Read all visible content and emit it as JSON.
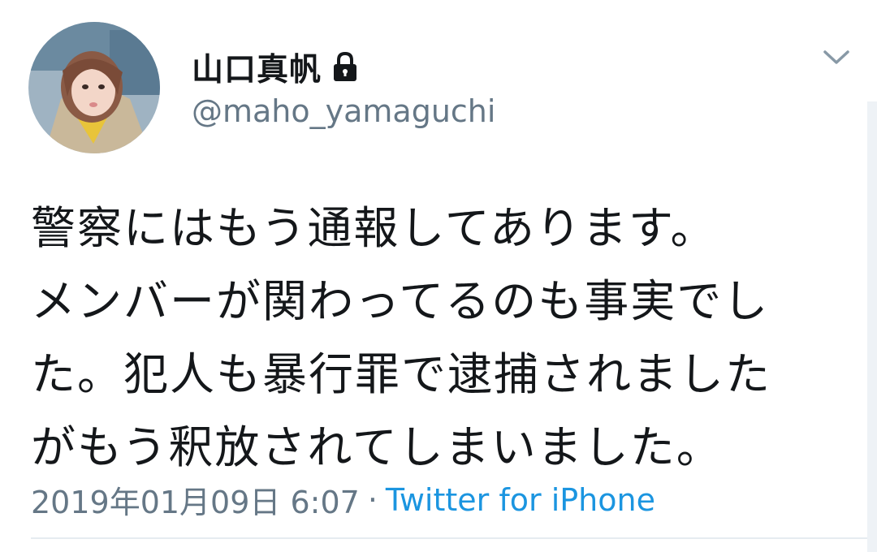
{
  "user": {
    "display_name": "山口真帆",
    "handle": "@maho_yamaguchi",
    "protected_icon": "lock-icon",
    "avatar_icon": "avatar-photo"
  },
  "menu": {
    "icon": "chevron-down-icon"
  },
  "tweet": {
    "lines": [
      "警察にはもう通報してあります。",
      "メンバーが関わってるのも事実でし",
      "た。犯人も暴行罪で逮捕されました",
      "がもう釈放されてしまいました。"
    ]
  },
  "meta": {
    "timestamp": "2019年01月09日 6:07",
    "separator": "·",
    "source": "Twitter for iPhone"
  },
  "colors": {
    "text": "#14171a",
    "secondary": "#657786",
    "link": "#1b95e0"
  }
}
